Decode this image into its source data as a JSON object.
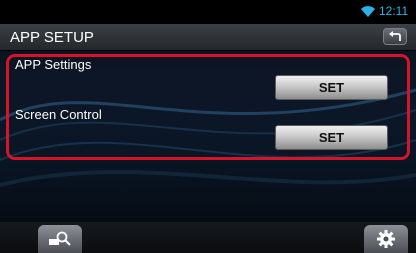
{
  "status_bar": {
    "time": "12:11",
    "wifi_icon": "wifi-icon"
  },
  "header": {
    "title": "APP SETUP",
    "back_icon": "back-arrow-icon"
  },
  "settings": [
    {
      "label": "APP Settings",
      "button_label": "SET"
    },
    {
      "label": "Screen Control",
      "button_label": "SET"
    }
  ],
  "bottom_bar": {
    "left_icon": "source-search-icon",
    "right_icon": "gear-icon"
  },
  "colors": {
    "accent": "#2bb3e8",
    "highlight": "#d5142a"
  }
}
